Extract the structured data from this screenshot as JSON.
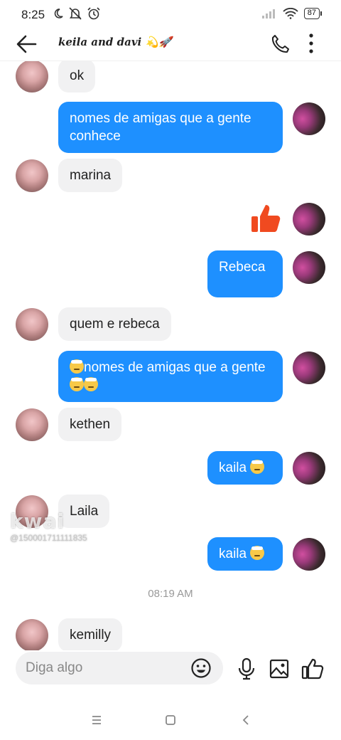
{
  "status_bar": {
    "time": "8:25",
    "battery": "87"
  },
  "header": {
    "title": "keila and davi 💫🚀"
  },
  "messages": [
    {
      "direction": "in",
      "text": "ok"
    },
    {
      "direction": "out",
      "text": "nomes de amigas que a gente conhece"
    },
    {
      "direction": "in",
      "text": "marina"
    },
    {
      "direction": "out",
      "type": "like-sticker",
      "icon": "thumbs-up-icon",
      "color": "#f04a20"
    },
    {
      "direction": "out",
      "text": "Rebeca"
    },
    {
      "direction": "in",
      "text": "quem e rebeca"
    },
    {
      "direction": "out",
      "text": "nomes de amigas que a gente",
      "emojis": [
        "face-with-head-bandage",
        "face-with-head-bandage",
        "face-with-head-bandage"
      ]
    },
    {
      "direction": "in",
      "text": "kethen"
    },
    {
      "direction": "out",
      "text": "kaila",
      "emojis": [
        "face-with-head-bandage"
      ]
    },
    {
      "direction": "in",
      "text": "Laila"
    },
    {
      "direction": "out",
      "text": "kaila",
      "emojis": [
        "face-with-head-bandage"
      ]
    },
    {
      "direction": "in",
      "text": "kemilly"
    }
  ],
  "timestamp_separator": "08:19 AM",
  "watermark": {
    "brand": "kwai",
    "id": "@150001711111835"
  },
  "composer": {
    "placeholder": "Diga algo"
  },
  "colors": {
    "outgoing_bubble": "#1e90ff",
    "incoming_bubble": "#f1f1f2",
    "like_icon": "#f04a20"
  }
}
